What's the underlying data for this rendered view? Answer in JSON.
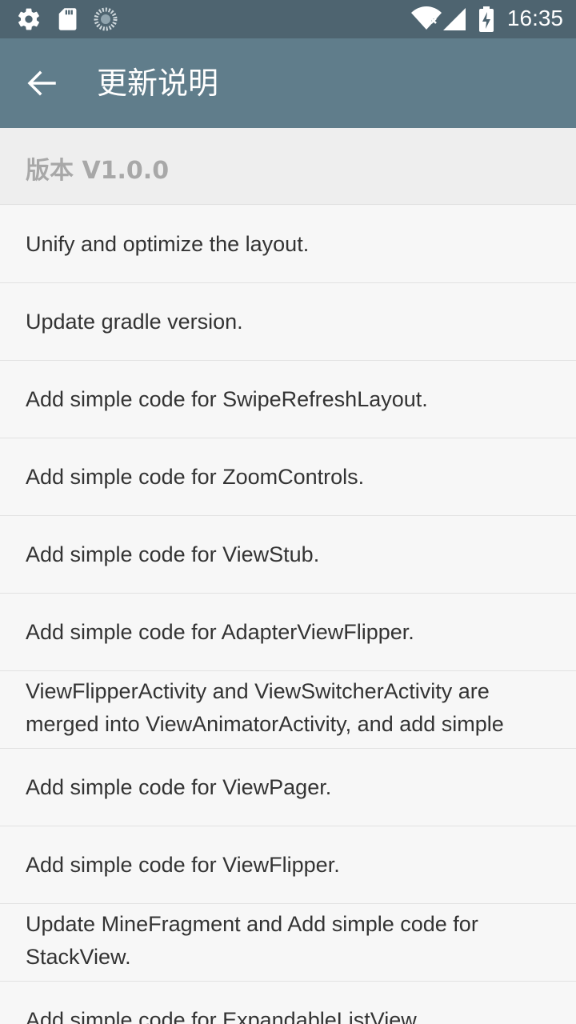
{
  "status_bar": {
    "time": "16:35",
    "icons": [
      "gear-icon",
      "sd-card-icon",
      "sync-icon",
      "wifi-icon",
      "signal-icon",
      "battery-charging-icon"
    ]
  },
  "app_bar": {
    "back_icon": "arrow-left-icon",
    "title": "更新说明"
  },
  "version_header": {
    "label": "版本 V1.0.0"
  },
  "changelog": [
    "Unify and optimize the layout.",
    "Update gradle version.",
    "Add simple code for SwipeRefreshLayout.",
    "Add simple code for ZoomControls.",
    "Add simple code for ViewStub.",
    "Add simple code for AdapterViewFlipper.",
    "ViewFlipperActivity and ViewSwitcherActivity are merged into ViewAnimatorActivity, and add simple",
    "Add simple code for ViewPager.",
    "Add simple code for ViewFlipper.",
    "Update MineFragment and Add simple code for StackView.",
    "Add simple code for ExpandableListView."
  ],
  "colors": {
    "status_bar": "#4e6470",
    "app_bar": "#607d8b",
    "header_bg": "#eeeeee",
    "list_bg": "#f7f7f7"
  }
}
